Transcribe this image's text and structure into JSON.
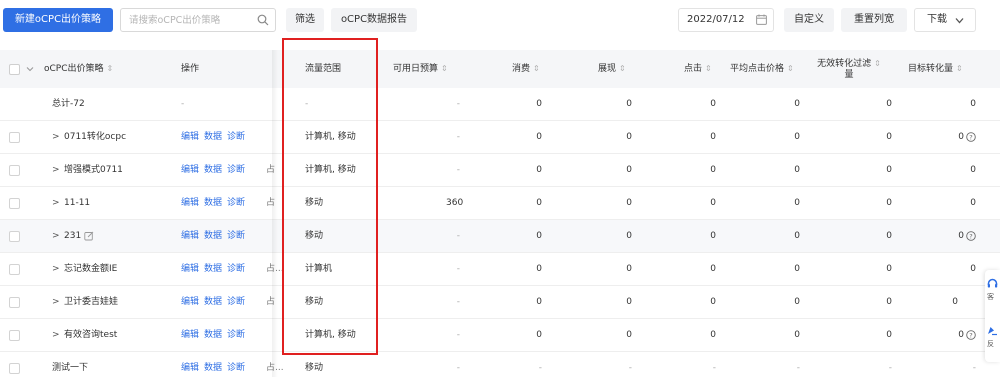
{
  "toolbar": {
    "new_button": "新建oCPC出价策略",
    "search_placeholder": "请搜索oCPC出价策略",
    "filter_button": "筛选",
    "report_button": "oCPC数据报告",
    "date_value": "2022/07/12",
    "custom_button": "自定义",
    "reset_button": "重置列宽",
    "download_button": "下载"
  },
  "columns": {
    "name": "oCPC出价策略",
    "ops": "操作",
    "range": "流量范围",
    "budget": "可用日预算",
    "spend": "消费",
    "show": "展现",
    "click": "点击",
    "cpc": "平均点击价格",
    "invalid_line1": "无效转化过滤",
    "invalid_line2": "量",
    "target": "目标转化量",
    "sort_glyph": "⇕"
  },
  "ops_labels": {
    "edit": "编辑",
    "data": "数据",
    "diagnose": "诊断"
  },
  "total_row": {
    "name": "总计-72",
    "ops": "-",
    "range": "-",
    "budget": "-",
    "spend": "0",
    "show": "0",
    "click": "0",
    "cpc": "0",
    "conv": "0",
    "target": "0"
  },
  "rows": [
    {
      "arrow": ">",
      "name": "0711转化ocpc",
      "trunc": "",
      "range": "计算机, 移动",
      "budget": "-",
      "spend": "0",
      "show": "0",
      "click": "0",
      "cpc": "0",
      "conv": "0",
      "target": "0"
    },
    {
      "arrow": ">",
      "name": "增强模式0711",
      "trunc": "占",
      "range": "计算机, 移动",
      "budget": "-",
      "spend": "0",
      "show": "0",
      "click": "0",
      "cpc": "0",
      "conv": "0",
      "target": "0"
    },
    {
      "arrow": ">",
      "name": "11-11",
      "trunc": "占",
      "range": "移动",
      "budget": "360",
      "spend": "0",
      "show": "0",
      "click": "0",
      "cpc": "0",
      "conv": "0",
      "target": "0"
    },
    {
      "arrow": ">",
      "name": "231",
      "trunc": "",
      "range": "移动",
      "budget": "-",
      "spend": "0",
      "show": "0",
      "click": "0",
      "cpc": "0",
      "conv": "0",
      "target": "0"
    },
    {
      "arrow": ">",
      "name": "忘记数金额IE",
      "trunc": "占...",
      "range": "计算机",
      "budget": "-",
      "spend": "0",
      "show": "0",
      "click": "0",
      "cpc": "0",
      "conv": "0",
      "target": "0"
    },
    {
      "arrow": ">",
      "name": "卫计委吉娃娃",
      "trunc": "占",
      "range": "移动",
      "budget": "-",
      "spend": "0",
      "show": "0",
      "click": "0",
      "cpc": "0",
      "conv": "0",
      "target": "0"
    },
    {
      "arrow": ">",
      "name": "有效咨询test",
      "trunc": "",
      "range": "计算机, 移动",
      "budget": "-",
      "spend": "0",
      "show": "0",
      "click": "0",
      "cpc": "0",
      "conv": "0",
      "target": "0"
    },
    {
      "arrow": "",
      "name": "测试一下",
      "trunc": "占...",
      "range": "移动",
      "budget": "-",
      "spend": "-",
      "show": "-",
      "click": "-",
      "cpc": "-",
      "conv": "-",
      "target": "-"
    }
  ],
  "float_labels": [
    "客",
    "反"
  ],
  "colors": {
    "primary": "#2f6fe4",
    "highlight": "#e02020",
    "header_bg": "#f5f6f8"
  }
}
